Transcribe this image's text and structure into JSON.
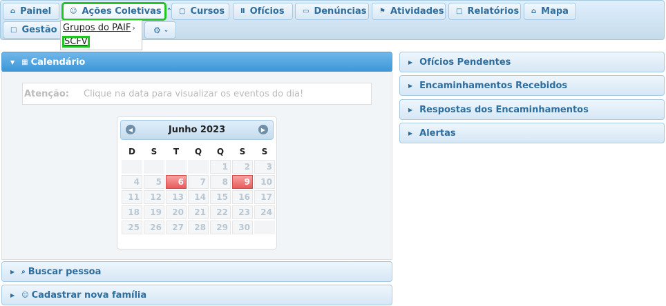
{
  "nav": {
    "painel": "Painel",
    "acoes": "Ações Coletivas",
    "cursos": "Cursos",
    "oficios": "Ofícios",
    "denuncias": "Denúncias",
    "atividades": "Atividades",
    "relatorios": "Relatórios",
    "mapa": "Mapa",
    "gestao": "Gestão D"
  },
  "dropdown": {
    "grupos_paif": "Grupos do PAIF",
    "scfv": "SCFV"
  },
  "calendar": {
    "title": "Calendário",
    "attention_label": "Atenção:",
    "attention_text": "Clique na data para visualizar os eventos do dia!",
    "month": "Junho 2023",
    "weekdays": [
      "D",
      "S",
      "T",
      "Q",
      "Q",
      "S",
      "S"
    ],
    "weeks": [
      [
        "",
        "",
        "",
        "",
        "1",
        "2",
        "3"
      ],
      [
        "4",
        "5",
        "6",
        "7",
        "8",
        "9",
        "10"
      ],
      [
        "11",
        "12",
        "13",
        "14",
        "15",
        "16",
        "17"
      ],
      [
        "18",
        "19",
        "20",
        "21",
        "22",
        "23",
        "24"
      ],
      [
        "25",
        "26",
        "27",
        "28",
        "29",
        "30",
        ""
      ]
    ],
    "event_days": [
      "6",
      "9"
    ]
  },
  "left_panels": {
    "buscar": "Buscar pessoa",
    "cadastrar": "Cadastrar nova família"
  },
  "right_panels": {
    "oficios_pendentes": "Ofícios Pendentes",
    "encaminhamentos_recebidos": "Encaminhamentos Recebidos",
    "respostas": "Respostas dos Encaminhamentos",
    "alertas": "Alertas"
  },
  "colors": {
    "header_active": "#4b9fdb",
    "event_day": "#e85b5b",
    "highlight_outline": "#22c322"
  }
}
